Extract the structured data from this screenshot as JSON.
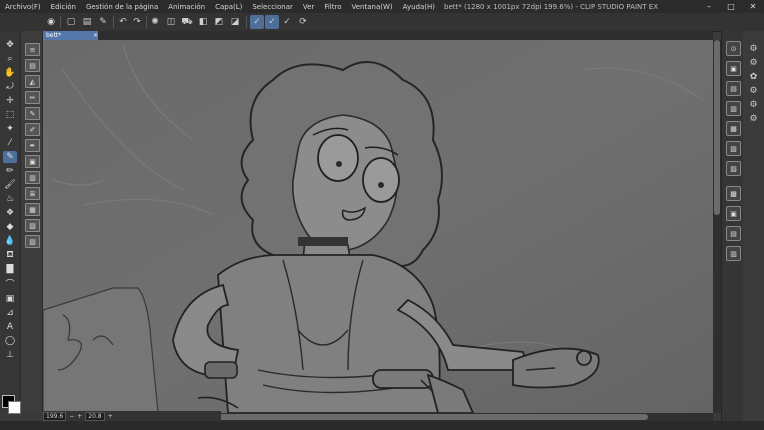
{
  "menu": {
    "items": [
      "Archivo(F)",
      "Edición",
      "Gestión de la página",
      "Animación",
      "Capa(L)",
      "Seleccionar",
      "Ver",
      "Filtro",
      "Ventana(W)",
      "Ayuda(H)"
    ],
    "window_title": "bett* (1280 x 1001px 72dpi 199.6%) - CLIP STUDIO PAINT EX"
  },
  "window_controls": {
    "minimize": "–",
    "maximize": "□",
    "close": "✕"
  },
  "document": {
    "tab_name": "bett*",
    "tab_close": "×"
  },
  "status": {
    "zoom": "199.6",
    "zoom_minus": "−",
    "zoom_plus": "+",
    "rotation": "20.8",
    "rotate_plus": "+"
  },
  "toolbar_icons": [
    "eye-icon",
    "undo-icon",
    "redo-icon",
    "clear-icon",
    "fill-icon",
    "transform-icon",
    "select-all-icon",
    "invert-selection-icon",
    "crop-icon",
    "layer-icon",
    "pen-stroke-1-icon",
    "pen-stroke-2-icon",
    "pen-stroke-3-icon",
    "sync-icon"
  ],
  "tools_left": [
    "move-icon",
    "zoom-icon",
    "hand-icon",
    "rotate-icon",
    "operation-icon",
    "select-icon",
    "lasso-icon",
    "eyedropper-icon",
    "pen-icon",
    "pencil-icon",
    "brush-icon",
    "airbrush-icon",
    "decorate-icon",
    "eraser-icon",
    "blend-icon",
    "fill-icon",
    "gradient-icon",
    "figure-icon",
    "frame-icon",
    "text-icon",
    "balloon-icon",
    "ruler-icon",
    "correct-icon"
  ],
  "colors": {
    "main": "#000000",
    "sub": "#ffffff",
    "accent": "#4d6f9a"
  }
}
